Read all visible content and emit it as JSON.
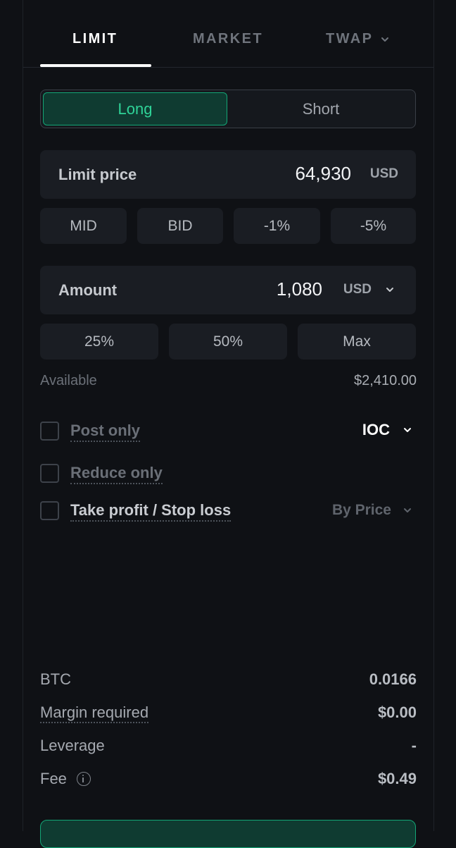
{
  "tabs": [
    {
      "label": "LIMIT",
      "active": true
    },
    {
      "label": "MARKET",
      "active": false
    },
    {
      "label": "TWAP",
      "active": false
    }
  ],
  "side": {
    "long_label": "Long",
    "short_label": "Short",
    "selected": "Long"
  },
  "limit_price": {
    "label": "Limit price",
    "value": "64,930",
    "unit": "USD"
  },
  "price_presets": [
    "MID",
    "BID",
    "-1%",
    "-5%"
  ],
  "amount": {
    "label": "Amount",
    "value": "1,080",
    "unit": "USD"
  },
  "amount_presets": [
    "25%",
    "50%",
    "Max"
  ],
  "available": {
    "label": "Available",
    "value": "$2,410.00"
  },
  "options": {
    "post_only": {
      "label": "Post only",
      "checked": false
    },
    "reduce_only": {
      "label": "Reduce only",
      "checked": false
    },
    "tp_sl": {
      "label": "Take profit / Stop loss",
      "checked": false
    },
    "time_in_force": "IOC",
    "tp_sl_mode": "By Price"
  },
  "summary": {
    "btc": {
      "label": "BTC",
      "value": "0.0166"
    },
    "margin": {
      "label": "Margin required",
      "value": "$0.00"
    },
    "leverage": {
      "label": "Leverage",
      "value": "-"
    },
    "fee": {
      "label": "Fee",
      "value": "$0.49"
    }
  },
  "colors": {
    "background": "#0f1115",
    "accent_green": "#2fd398",
    "long_fill": "#0f3b31",
    "field_bg": "#1a1d23"
  },
  "icons": {
    "dropdown": "chevron-down-icon",
    "info": "info-icon"
  }
}
